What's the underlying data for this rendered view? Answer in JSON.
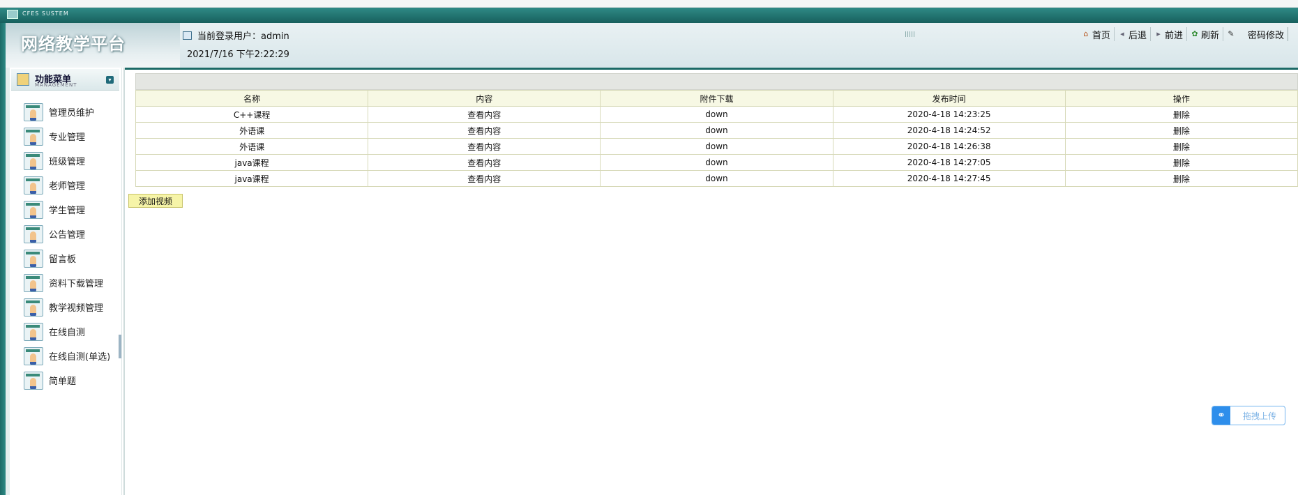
{
  "app": {
    "system_label": "CFES SUSTEM",
    "brand_title": "网络教学平台"
  },
  "header": {
    "user_prefix": "当前登录用户：",
    "username": "admin",
    "datetime": "2021/7/16 下午2:22:29",
    "links": [
      {
        "label": "首页",
        "icon": "home-icon"
      },
      {
        "label": "后退",
        "icon": "back-icon"
      },
      {
        "label": "前进",
        "icon": "forward-icon"
      },
      {
        "label": "刷新",
        "icon": "refresh-icon"
      },
      {
        "label": "密码修改",
        "icon": "password-edit-icon"
      }
    ]
  },
  "sidebar": {
    "title": "功能菜单",
    "subtitle": "MANAGEMENT",
    "items": [
      {
        "label": "管理员维护"
      },
      {
        "label": "专业管理"
      },
      {
        "label": "班级管理"
      },
      {
        "label": "老师管理"
      },
      {
        "label": "学生管理"
      },
      {
        "label": "公告管理"
      },
      {
        "label": "留言板"
      },
      {
        "label": "资料下载管理"
      },
      {
        "label": "教学视频管理"
      },
      {
        "label": "在线自测"
      },
      {
        "label": "在线自测(单选)"
      },
      {
        "label": "简单题"
      }
    ]
  },
  "table": {
    "columns": [
      "名称",
      "内容",
      "附件下载",
      "发布时间",
      "操作"
    ],
    "rows": [
      {
        "name": "C++课程",
        "content": "查看内容",
        "download": "down",
        "time": "2020-4-18 14:23:25",
        "action": "删除"
      },
      {
        "name": "外语课",
        "content": "查看内容",
        "download": "down",
        "time": "2020-4-18 14:24:52",
        "action": "删除"
      },
      {
        "name": "外语课",
        "content": "查看内容",
        "download": "down",
        "time": "2020-4-18 14:26:38",
        "action": "删除"
      },
      {
        "name": "java课程",
        "content": "查看内容",
        "download": "down",
        "time": "2020-4-18 14:27:05",
        "action": "删除"
      },
      {
        "name": "java课程",
        "content": "查看内容",
        "download": "down",
        "time": "2020-4-18 14:27:45",
        "action": "删除"
      }
    ]
  },
  "actions": {
    "add_video": "添加视频",
    "drag_upload": "拖拽上传"
  },
  "colors": {
    "theme": "#1c6a66",
    "link_red": "#e00000",
    "header_row": "#f7f8e4",
    "button_yellow": "#f6f4a8",
    "upload_blue": "#2e8eeb"
  }
}
